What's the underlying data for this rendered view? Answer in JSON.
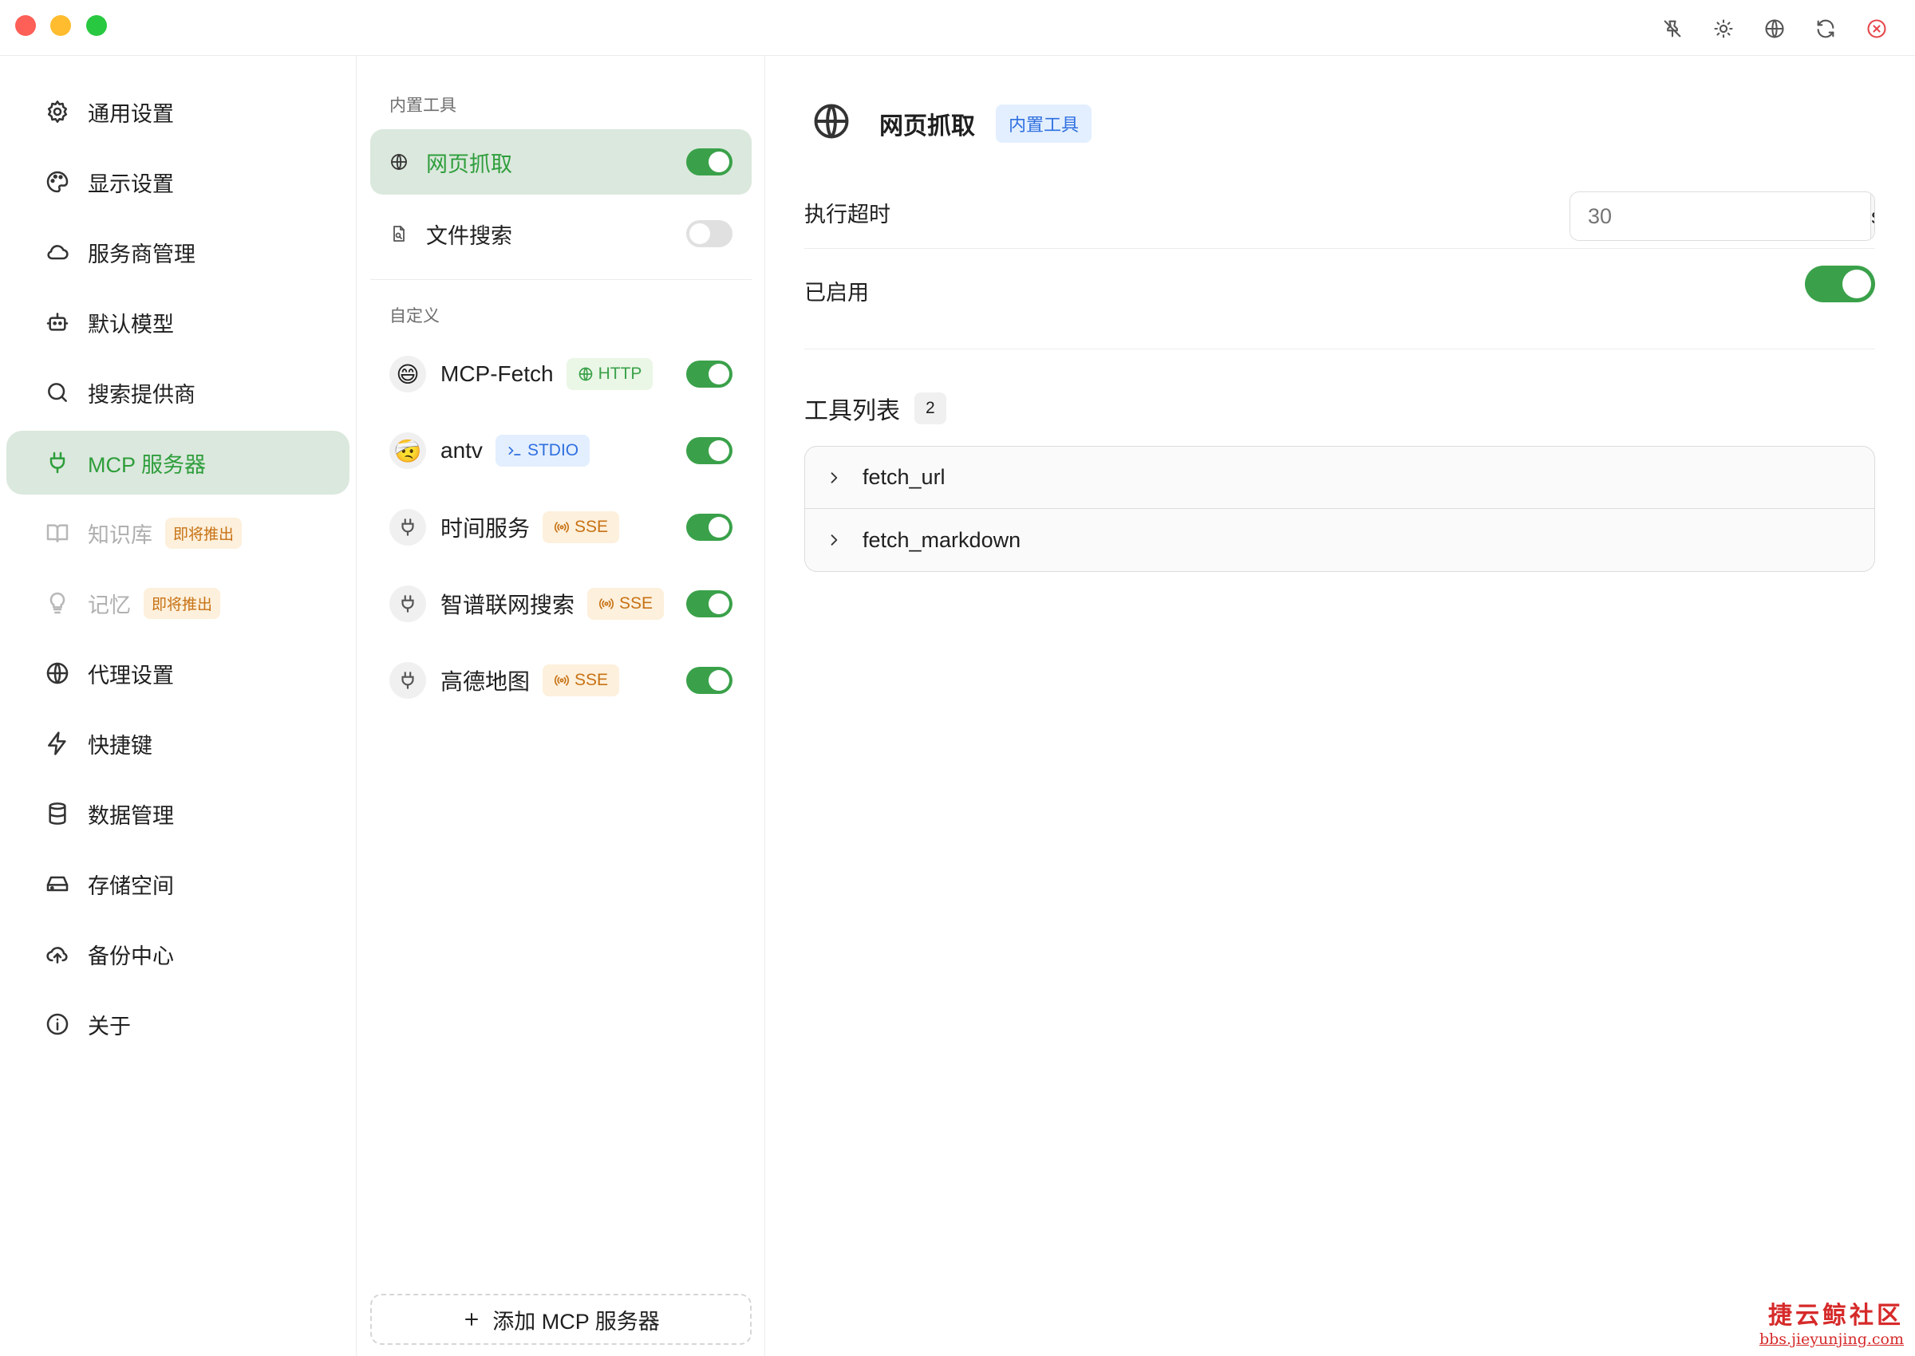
{
  "titlebar": {
    "icons": [
      "pin-off-icon",
      "sun-icon",
      "globe-icon",
      "refresh-icon",
      "close-circle-icon"
    ]
  },
  "sidebar": {
    "items": [
      {
        "label": "通用设置",
        "icon": "gear-icon"
      },
      {
        "label": "显示设置",
        "icon": "palette-icon"
      },
      {
        "label": "服务商管理",
        "icon": "cloud-icon"
      },
      {
        "label": "默认模型",
        "icon": "bot-icon"
      },
      {
        "label": "搜索提供商",
        "icon": "search-icon"
      },
      {
        "label": "MCP 服务器",
        "icon": "plug-icon",
        "active": true
      },
      {
        "label": "知识库",
        "icon": "book-icon",
        "badge": "即将推出",
        "disabled": true
      },
      {
        "label": "记忆",
        "icon": "lightbulb-icon",
        "badge": "即将推出",
        "disabled": true
      },
      {
        "label": "代理设置",
        "icon": "globe-icon"
      },
      {
        "label": "快捷键",
        "icon": "zap-icon"
      },
      {
        "label": "数据管理",
        "icon": "database-icon"
      },
      {
        "label": "存储空间",
        "icon": "hard-drive-icon"
      },
      {
        "label": "备份中心",
        "icon": "cloud-upload-icon"
      },
      {
        "label": "关于",
        "icon": "info-icon"
      }
    ]
  },
  "middle": {
    "builtin_label": "内置工具",
    "builtin_tools": [
      {
        "label": "网页抓取",
        "icon": "globe-icon",
        "enabled": true,
        "active": true
      },
      {
        "label": "文件搜索",
        "icon": "file-search-icon",
        "enabled": false
      }
    ],
    "custom_label": "自定义",
    "servers": [
      {
        "name": "MCP-Fetch",
        "avatar": "😄",
        "tag": "HTTP",
        "tag_type": "http",
        "enabled": true
      },
      {
        "name": "antv",
        "avatar": "🤕",
        "tag": "STDIO",
        "tag_type": "stdio",
        "enabled": true
      },
      {
        "name": "时间服务",
        "avatar": "plug",
        "tag": "SSE",
        "tag_type": "sse",
        "enabled": true
      },
      {
        "name": "智谱联网搜索",
        "avatar": "plug",
        "tag": "SSE",
        "tag_type": "sse",
        "enabled": true
      },
      {
        "name": "高德地图",
        "avatar": "plug",
        "tag": "SSE",
        "tag_type": "sse",
        "enabled": true
      }
    ],
    "add_button": "添加 MCP 服务器"
  },
  "detail": {
    "title": "网页抓取",
    "tag": "内置工具",
    "timeout_label": "执行超时",
    "timeout_placeholder": "30",
    "timeout_unit": "s",
    "enabled_label": "已启用",
    "enabled": true,
    "tools_title": "工具列表",
    "tools_count": "2",
    "tools": [
      "fetch_url",
      "fetch_markdown"
    ]
  },
  "watermark": {
    "line1": "捷云鲸社区",
    "line2": "bbs.jieyunjing.com"
  },
  "colors": {
    "accent": "#2e9e3c",
    "active_bg": "#dbe8dd",
    "toggle_on": "#3aa14a",
    "soon_badge_bg": "#fdf0dc",
    "soon_badge_fg": "#c77214",
    "stdio_fg": "#2f6fe0",
    "watermark": "#d62a2a"
  }
}
